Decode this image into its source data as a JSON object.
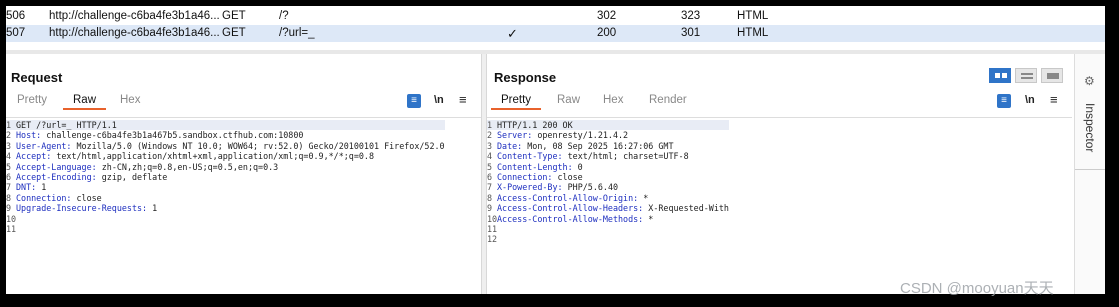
{
  "history": {
    "rows": [
      {
        "num": "506",
        "host": "http://challenge-c6ba4fe3b1a46...",
        "method": "GET",
        "url": "/?",
        "check": "",
        "status": "302",
        "length": "323",
        "mime": "HTML"
      },
      {
        "num": "507",
        "host": "http://challenge-c6ba4fe3b1a46...",
        "method": "GET",
        "url": "/?url=_",
        "check": "✓",
        "status": "200",
        "length": "301",
        "mime": "HTML"
      }
    ]
  },
  "request": {
    "title": "Request",
    "tabs": [
      "Pretty",
      "Raw",
      "Hex"
    ],
    "active_tab": "Raw",
    "tools": {
      "wrap": "≡",
      "newline": "\\n",
      "menu": "≡"
    },
    "lines": [
      {
        "n": "1",
        "key": "",
        "sep": "",
        "val": "GET /?url=_ HTTP/1.1"
      },
      {
        "n": "2",
        "key": "Host",
        "sep": ":",
        "val": " challenge-c6ba4fe3b1a467b5.sandbox.ctfhub.com:10800"
      },
      {
        "n": "3",
        "key": "User-Agent",
        "sep": ":",
        "val": " Mozilla/5.0 (Windows NT 10.0; WOW64; rv:52.0) Gecko/20100101 Firefox/52.0"
      },
      {
        "n": "4",
        "key": "Accept",
        "sep": ":",
        "val": " text/html,application/xhtml+xml,application/xml;q=0.9,*/*;q=0.8"
      },
      {
        "n": "5",
        "key": "Accept-Language",
        "sep": ":",
        "val": " zh-CN,zh;q=0.8,en-US;q=0.5,en;q=0.3"
      },
      {
        "n": "6",
        "key": "Accept-Encoding",
        "sep": ":",
        "val": " gzip, deflate"
      },
      {
        "n": "7",
        "key": "DNT",
        "sep": ":",
        "val": " 1"
      },
      {
        "n": "8",
        "key": "Connection",
        "sep": ":",
        "val": " close"
      },
      {
        "n": "9",
        "key": "Upgrade-Insecure-Requests",
        "sep": ":",
        "val": " 1"
      },
      {
        "n": "10",
        "key": "",
        "sep": "",
        "val": ""
      },
      {
        "n": "11",
        "key": "",
        "sep": "",
        "val": ""
      }
    ]
  },
  "response": {
    "title": "Response",
    "tabs": [
      "Pretty",
      "Raw",
      "Hex",
      "Render"
    ],
    "active_tab": "Pretty",
    "tools": {
      "wrap": "≡",
      "newline": "\\n",
      "menu": "≡"
    },
    "lines": [
      {
        "n": "1",
        "key": "",
        "sep": "",
        "val": "HTTP/1.1 200 OK"
      },
      {
        "n": "2",
        "key": "Server",
        "sep": ":",
        "val": " openresty/1.21.4.2"
      },
      {
        "n": "3",
        "key": "Date",
        "sep": ":",
        "val": " Mon, 08 Sep 2025 16:27:06 GMT"
      },
      {
        "n": "4",
        "key": "Content-Type",
        "sep": ":",
        "val": " text/html; charset=UTF-8"
      },
      {
        "n": "5",
        "key": "Content-Length",
        "sep": ":",
        "val": " 0"
      },
      {
        "n": "6",
        "key": "Connection",
        "sep": ":",
        "val": " close"
      },
      {
        "n": "7",
        "key": "X-Powered-By",
        "sep": ":",
        "val": " PHP/5.6.40"
      },
      {
        "n": "8",
        "key": "Access-Control-Allow-Origin",
        "sep": ":",
        "val": " *"
      },
      {
        "n": "9",
        "key": "Access-Control-Allow-Headers",
        "sep": ":",
        "val": " X-Requested-With"
      },
      {
        "n": "10",
        "key": "Access-Control-Allow-Methods",
        "sep": ":",
        "val": " *"
      },
      {
        "n": "11",
        "key": "",
        "sep": "",
        "val": ""
      },
      {
        "n": "12",
        "key": "",
        "sep": "",
        "val": ""
      }
    ]
  },
  "inspector": {
    "label": "Inspector"
  },
  "watermark": "CSDN @mooyuan天天",
  "colors": {
    "accent": "#2f74c8",
    "tab_underline": "#e8622c",
    "header_key": "#1e2fbf",
    "selected_row": "#dde8f7"
  }
}
